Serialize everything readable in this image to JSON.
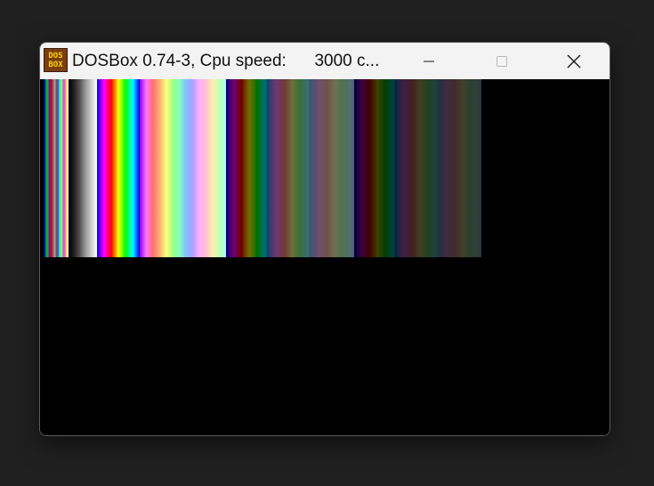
{
  "window": {
    "title": "DOSBox 0.74-3, Cpu speed:      3000 c..."
  },
  "app_icon": {
    "line1": "DOS",
    "line2": "BOX"
  },
  "controls": {
    "minimize_icon": "minimize-icon",
    "maximize_icon": "maximize-icon",
    "close_icon": "close-icon"
  },
  "colors": {
    "titlebar": "#f3f3f3",
    "client_background": "#000000",
    "icon_background": "#7a3e12",
    "icon_text": "#ffd400"
  },
  "palette_groups": [
    {
      "name": "ega-16",
      "gradient": "linear-gradient(to right,#000,#00a,#0a0,#0aa,#a00,#a0a,#a50,#aaa,#555,#55f,#5f5,#5ff,#f55,#f5f,#ff5,#fff)"
    },
    {
      "name": "gray-ramp",
      "gradient": "linear-gradient(to right,#000,#222,#555,#999,#ccc,#fff)"
    },
    {
      "name": "bright-hues",
      "gradient": "linear-gradient(to right,#00f,#8000ff,#f0f,#ff0080,#f00,#ff8000,#ff0,#80ff00,#0f0,#00ff80,#0ff,#0080ff,#00f)"
    },
    {
      "name": "mid-hues",
      "gradient": "linear-gradient(to right,#80f,#f7f,#ff7070,#ffb070,#ffff80,#a0ff80,#80ffc0,#80c0ff,#b0a0ff,#ffb0ff,#ffc0d0,#fff0b0,#c0ffb0,#a0ffff)"
    },
    {
      "name": "dark-hues",
      "gradient": "linear-gradient(to right,#000070,#400070,#700070,#700040,#700000,#704000,#707000,#407000,#007000,#007040,#007070,#004070)"
    },
    {
      "name": "dark-mid",
      "gradient": "linear-gradient(to right,#383870,#503870,#703870,#703850,#703838,#705038,#707038,#507038,#387038,#387050,#387070,#385070)"
    },
    {
      "name": "dark-pale",
      "gradient": "linear-gradient(to right,#505070,#585070,#705070,#705058,#705050,#706050,#707050,#607050,#507050,#507060,#507070,#506070)"
    },
    {
      "name": "darker-hues",
      "gradient": "linear-gradient(to right,#000040,#200040,#400040,#400020,#400000,#402000,#404000,#204000,#004000,#004020,#004040,#002040)"
    },
    {
      "name": "darker-mid",
      "gradient": "linear-gradient(to right,#202040,#302040,#402040,#402030,#402020,#403020,#404020,#304020,#204020,#204030,#204040,#203040)"
    },
    {
      "name": "darker-pale",
      "gradient": "linear-gradient(to right,#2c2c40,#342c40,#402c40,#402c34,#402c2c,#40342c,#40402c,#34402c,#2c402c,#2c4034,#2c4040,#2c3440)"
    }
  ]
}
